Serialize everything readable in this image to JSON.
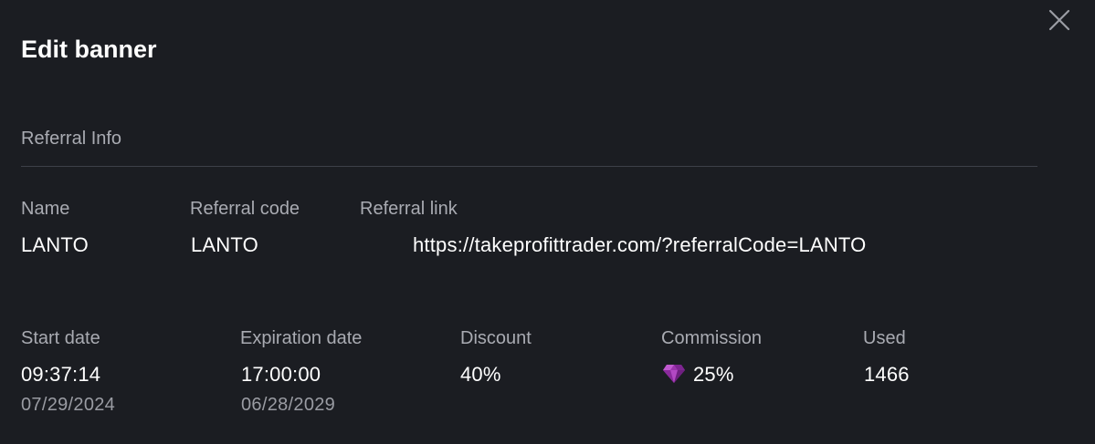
{
  "modal": {
    "title": "Edit banner",
    "close_icon": "close-icon"
  },
  "referral_info": {
    "section_title": "Referral Info",
    "name": {
      "label": "Name",
      "value": "LANTO"
    },
    "referral_code": {
      "label": "Referral code",
      "value": "LANTO"
    },
    "referral_link": {
      "label": "Referral link",
      "value": "https://takeprofittrader.com/?referralCode=LANTO"
    }
  },
  "details": {
    "start_date": {
      "label": "Start date",
      "time": "09:37:14",
      "date": "07/29/2024"
    },
    "expiration_date": {
      "label": "Expiration date",
      "time": "17:00:00",
      "date": "06/28/2029"
    },
    "discount": {
      "label": "Discount",
      "value": "40%"
    },
    "commission": {
      "label": "Commission",
      "value": "25%",
      "icon": "gem-icon",
      "icon_color": "#a23bb0"
    },
    "used": {
      "label": "Used",
      "value": "1466"
    }
  },
  "colors": {
    "background": "#1b1d22",
    "label": "#a9abb2",
    "value": "#ffffff",
    "divider": "#3d4048"
  }
}
